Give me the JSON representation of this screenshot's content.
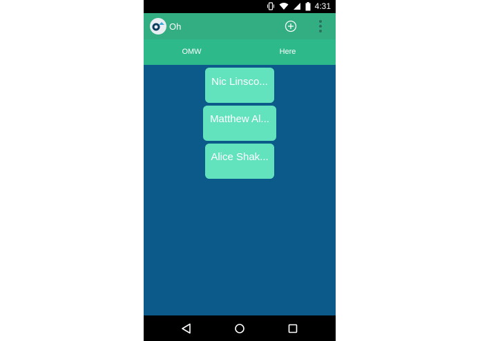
{
  "status_bar": {
    "time": "4:31",
    "icons": [
      "vibrate-icon",
      "wifi-icon",
      "signal-icon",
      "battery-icon"
    ]
  },
  "app_bar": {
    "title": "Oh",
    "logo_icon": "app-logo-icon",
    "actions": [
      "add-circle-icon",
      "overflow-menu-icon"
    ]
  },
  "tabs": [
    {
      "label": "OMW"
    },
    {
      "label": "Here"
    }
  ],
  "contacts": [
    {
      "name": "Nic Linsco..."
    },
    {
      "name": "Matthew Al..."
    },
    {
      "name": "Alice Shak..."
    }
  ],
  "nav_bar": {
    "icons": [
      "back-icon",
      "home-icon",
      "recents-icon"
    ]
  },
  "colors": {
    "background": "#0b5a89",
    "app_bar": "#33ad82",
    "tab_bar": "#2eb98a",
    "card": "#63e3bd"
  }
}
